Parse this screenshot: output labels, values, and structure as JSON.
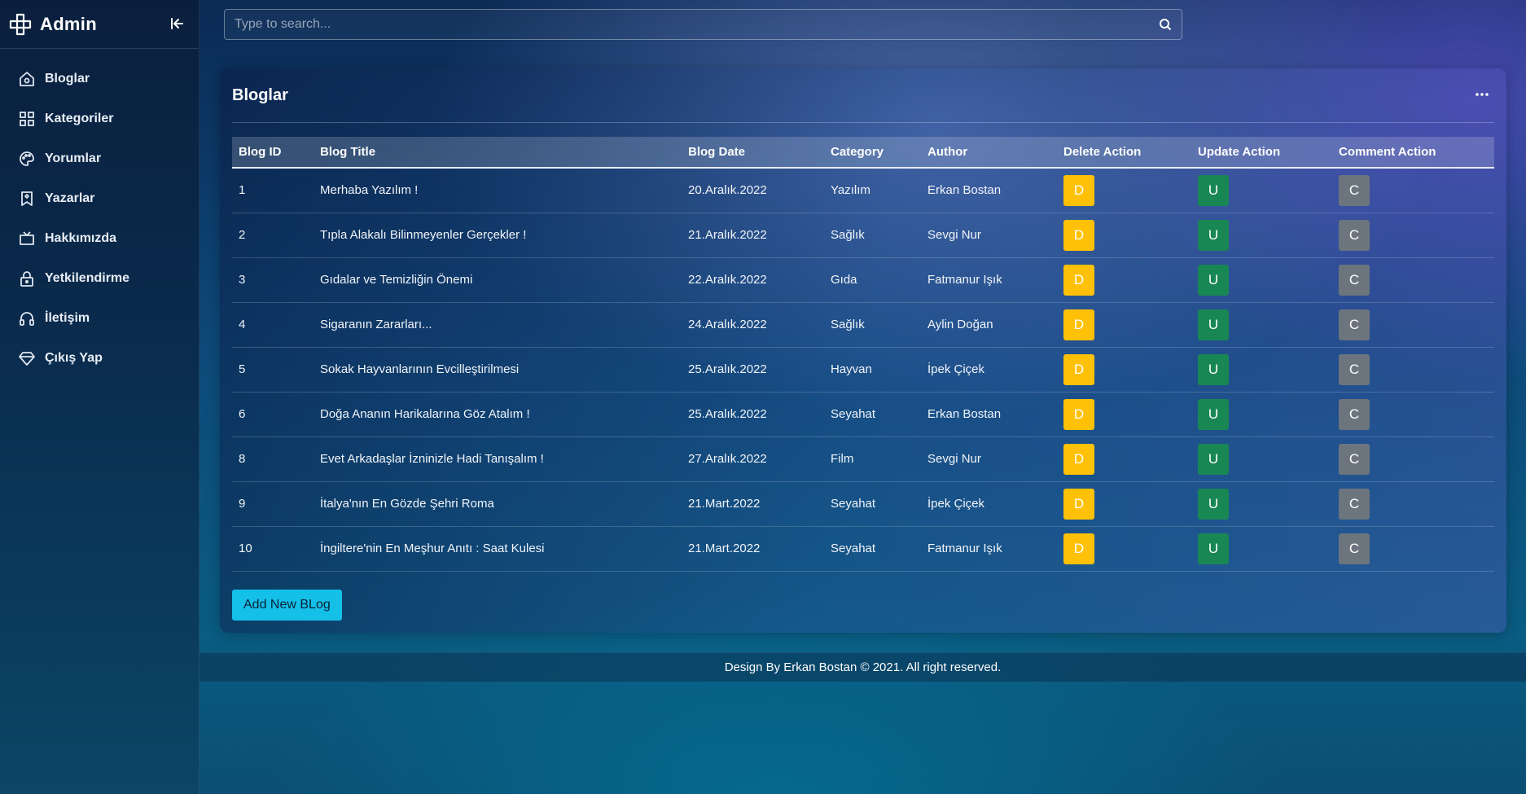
{
  "sidebar": {
    "brand": "Admin",
    "items": [
      {
        "label": "Bloglar",
        "icon": "home-icon"
      },
      {
        "label": "Kategoriler",
        "icon": "grid-icon"
      },
      {
        "label": "Yorumlar",
        "icon": "palette-icon"
      },
      {
        "label": "Yazarlar",
        "icon": "bookmark-icon"
      },
      {
        "label": "Hakkımızda",
        "icon": "tv-icon"
      },
      {
        "label": "Yetkilendirme",
        "icon": "lock-icon"
      },
      {
        "label": "İletişim",
        "icon": "headphones-icon"
      },
      {
        "label": "Çıkış Yap",
        "icon": "diamond-icon"
      }
    ]
  },
  "search": {
    "placeholder": "Type to search..."
  },
  "card": {
    "title": "Bloglar",
    "columns": [
      "Blog ID",
      "Blog Title",
      "Blog Date",
      "Category",
      "Author",
      "Delete Action",
      "Update Action",
      "Comment Action"
    ],
    "rows": [
      {
        "id": "1",
        "title": "Merhaba Yazılım !",
        "date": "20.Aralık.2022",
        "category": "Yazılım",
        "author": "Erkan Bostan",
        "d": "D",
        "u": "U",
        "c": "C"
      },
      {
        "id": "2",
        "title": "Tıpla Alakalı Bilinmeyenler Gerçekler !",
        "date": "21.Aralık.2022",
        "category": "Sağlık",
        "author": "Sevgi Nur",
        "d": "D",
        "u": "U",
        "c": "C"
      },
      {
        "id": "3",
        "title": "Gıdalar ve Temizliğin Önemi",
        "date": "22.Aralık.2022",
        "category": "Gıda",
        "author": "Fatmanur Işık",
        "d": "D",
        "u": "U",
        "c": "C"
      },
      {
        "id": "4",
        "title": "Sigaranın Zararları...",
        "date": "24.Aralık.2022",
        "category": "Sağlık",
        "author": "Aylin Doğan",
        "d": "D",
        "u": "U",
        "c": "C"
      },
      {
        "id": "5",
        "title": "Sokak Hayvanlarının Evcilleştirilmesi",
        "date": "25.Aralık.2022",
        "category": "Hayvan",
        "author": "İpek Çiçek",
        "d": "D",
        "u": "U",
        "c": "C"
      },
      {
        "id": "6",
        "title": "Doğa Ananın Harikalarına Göz Atalım !",
        "date": "25.Aralık.2022",
        "category": "Seyahat",
        "author": "Erkan Bostan",
        "d": "D",
        "u": "U",
        "c": "C"
      },
      {
        "id": "8",
        "title": "Evet Arkadaşlar İzninizle Hadi Tanışalım !",
        "date": "27.Aralık.2022",
        "category": "Film",
        "author": "Sevgi Nur",
        "d": "D",
        "u": "U",
        "c": "C"
      },
      {
        "id": "9",
        "title": "İtalya'nın En Gözde Şehri Roma",
        "date": "21.Mart.2022",
        "category": "Seyahat",
        "author": "İpek Çiçek",
        "d": "D",
        "u": "U",
        "c": "C"
      },
      {
        "id": "10",
        "title": "İngiltere'nin En Meşhur Anıtı : Saat Kulesi",
        "date": "21.Mart.2022",
        "category": "Seyahat",
        "author": "Fatmanur Işık",
        "d": "D",
        "u": "U",
        "c": "C"
      }
    ],
    "add_button": "Add New BLog"
  },
  "footer": {
    "text": "Design By Erkan Bostan © 2021. All right reserved."
  },
  "colors": {
    "delete": "#ffc107",
    "update": "#198754",
    "comment": "#6c757d",
    "add": "#14c0e8"
  }
}
